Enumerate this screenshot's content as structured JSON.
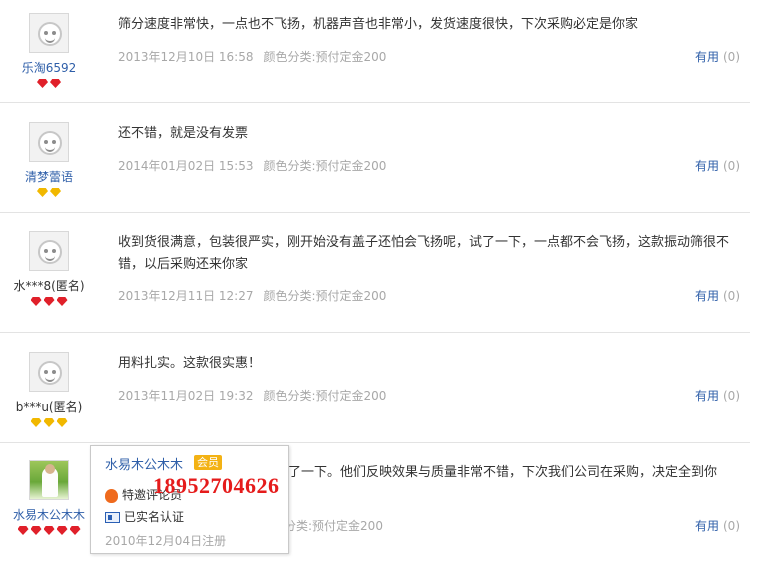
{
  "reviews": [
    {
      "username": "乐淘6592",
      "badge_type": "red",
      "badge_count": 2,
      "text": "筛分速度非常快，一点也不飞扬，机器声音也非常小，发货速度很快，下次采购必定是你家",
      "date": "2013年12月10日 16:58",
      "spec": "颜色分类:预付定金200",
      "helpful_label": "有用",
      "helpful_count": "(0)"
    },
    {
      "username": "清梦蕾语",
      "badge_type": "gold",
      "badge_count": 2,
      "text": "还不错，就是没有发票",
      "date": "2014年01月02日 15:53",
      "spec": "颜色分类:预付定金200",
      "helpful_label": "有用",
      "helpful_count": "(0)"
    },
    {
      "username": "水***8(匿名)",
      "badge_type": "red",
      "badge_count": 3,
      "text": "收到货很满意，包装很严实，刚开始没有盖子还怕会飞扬呢，试了一下，一点都不会飞扬，这款振动筛很不错，以后采购还来你家",
      "date": "2013年12月11日 12:27",
      "spec": "颜色分类:预付定金200",
      "helpful_label": "有用",
      "helpful_count": "(0)"
    },
    {
      "username": "b***u(匿名)",
      "badge_type": "gold",
      "badge_count": 3,
      "text": "用料扎实。这款很实惠！",
      "date": "2013年11月02日 19:32",
      "spec": "颜色分类:预付定金200",
      "helpful_label": "有用",
      "helpful_count": "(0)"
    },
    {
      "username": "水易木公木木",
      "badge_type": "red",
      "badge_count": 5,
      "text": "了一下。他们反映效果与质量非常不错，下次我们公司在采购，决定全到你",
      "date": "",
      "spec": "分类:预付定金200",
      "helpful_label": "有用",
      "helpful_count": "(0)"
    }
  ],
  "popup": {
    "name": "水易木公木木",
    "member_badge": "会员",
    "invite_label": "特邀评论员",
    "verified_label": "已实名认证",
    "registered": "2010年12月04日注册"
  },
  "overlay_phone": "18952704626",
  "colors": {
    "link_blue": "#2f5fa9",
    "meta_gray": "#a8a8a8",
    "phone_red": "#e51b1b",
    "gem_red": "#e0202a",
    "gem_gold": "#f1b800"
  }
}
